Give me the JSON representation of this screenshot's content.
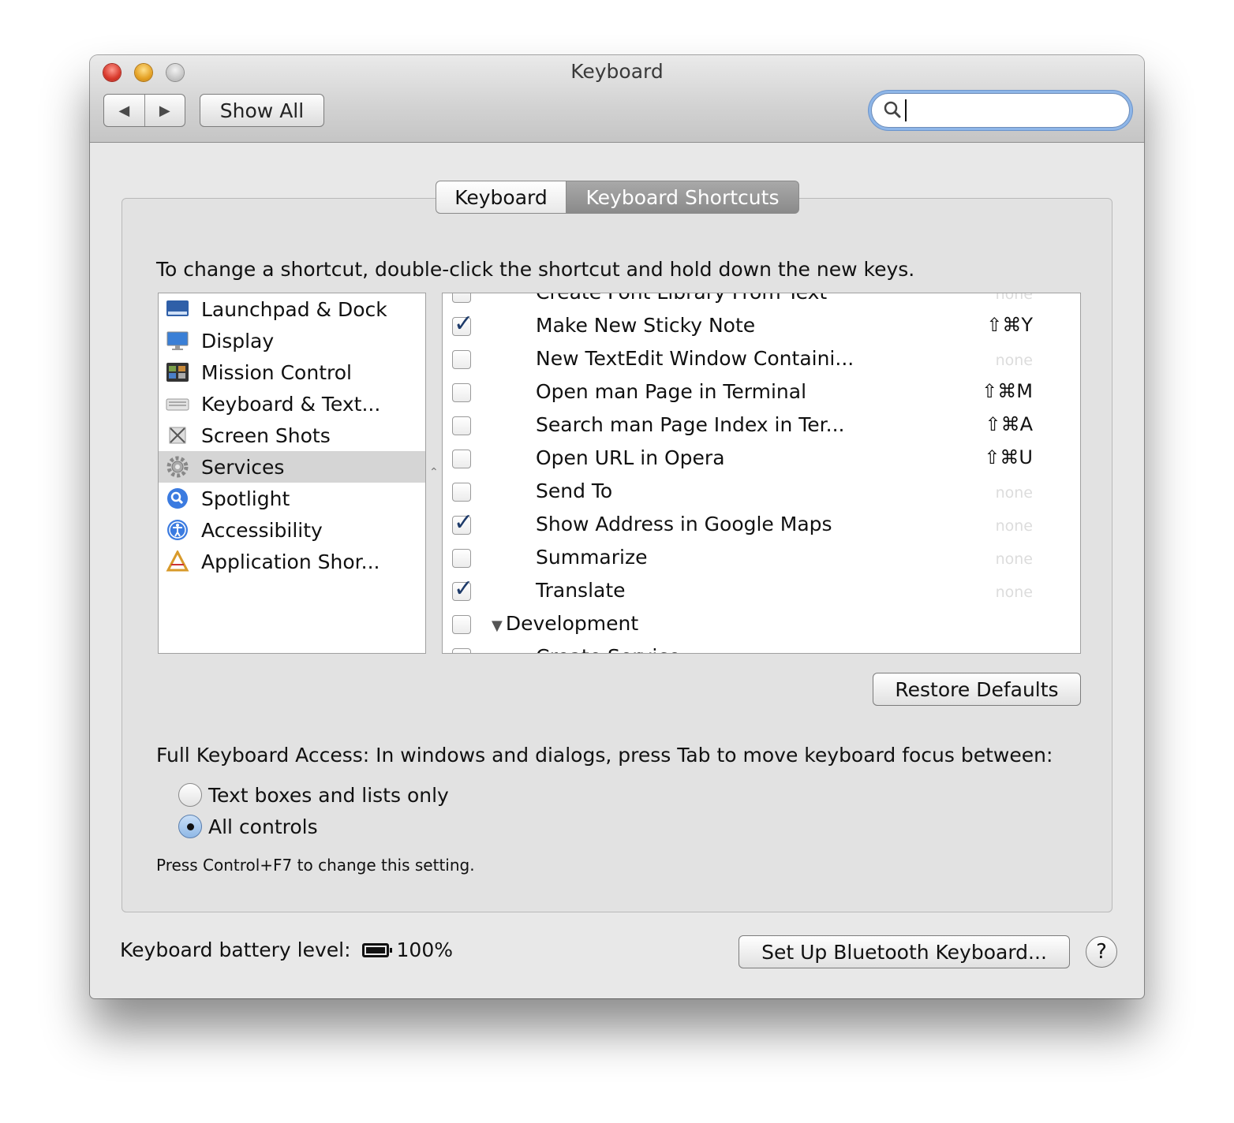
{
  "window": {
    "title": "Keyboard",
    "nav": {
      "back_icon": "◀",
      "forward_icon": "▶"
    },
    "show_all_label": "Show All",
    "search": {
      "value": "",
      "placeholder": ""
    }
  },
  "tabs": [
    {
      "label": "Keyboard",
      "selected": false
    },
    {
      "label": "Keyboard Shortcuts",
      "selected": true
    }
  ],
  "instruction": "To change a shortcut, double-click the shortcut and hold down the new keys.",
  "categories": [
    {
      "label": "Launchpad & Dock",
      "icon": "launchpad-dock-icon",
      "selected": false
    },
    {
      "label": "Display",
      "icon": "display-icon",
      "selected": false
    },
    {
      "label": "Mission Control",
      "icon": "mission-control-icon",
      "selected": false
    },
    {
      "label": "Keyboard & Text...",
      "icon": "keyboard-icon",
      "selected": false
    },
    {
      "label": "Screen Shots",
      "icon": "screenshot-icon",
      "selected": false
    },
    {
      "label": "Services",
      "icon": "gear-icon",
      "selected": true
    },
    {
      "label": "Spotlight",
      "icon": "spotlight-icon",
      "selected": false
    },
    {
      "label": "Accessibility",
      "icon": "accessibility-icon",
      "selected": false
    },
    {
      "label": "Application Shor...",
      "icon": "app-shortcuts-icon",
      "selected": false
    }
  ],
  "services": [
    {
      "label": "Create Font Library From Text",
      "checked": false,
      "shortcut": "none"
    },
    {
      "label": "Make New Sticky Note",
      "checked": true,
      "shortcut": "⇧⌘Y"
    },
    {
      "label": "New TextEdit Window Containi...",
      "checked": false,
      "shortcut": "none"
    },
    {
      "label": "Open man Page in Terminal",
      "checked": false,
      "shortcut": "⇧⌘M"
    },
    {
      "label": "Search man Page Index in Ter...",
      "checked": false,
      "shortcut": "⇧⌘A"
    },
    {
      "label": "Open URL in Opera",
      "checked": false,
      "shortcut": "⇧⌘U"
    },
    {
      "label": "Send To",
      "checked": false,
      "shortcut": "none"
    },
    {
      "label": "Show Address in Google Maps",
      "checked": true,
      "shortcut": "none"
    },
    {
      "label": "Summarize",
      "checked": false,
      "shortcut": "none"
    },
    {
      "label": "Translate",
      "checked": true,
      "shortcut": "none"
    }
  ],
  "services_group": {
    "label": "Development",
    "checked": false,
    "expanded": true
  },
  "services_next": {
    "label": "Create Service",
    "checked": false
  },
  "restore_defaults_label": "Restore Defaults",
  "full_keyboard_access": {
    "label": "Full Keyboard Access: In windows and dialogs, press Tab to move keyboard focus between:",
    "options": [
      {
        "label": "Text boxes and lists only",
        "selected": false
      },
      {
        "label": "All controls",
        "selected": true
      }
    ],
    "hint": "Press Control+F7 to change this setting."
  },
  "battery": {
    "label": "Keyboard battery level:",
    "value": "100%",
    "level": 1.0
  },
  "bluetooth_button_label": "Set Up Bluetooth Keyboard...",
  "help_label": "?",
  "colors": {
    "accent": "#8eb6e8",
    "selection": "#d5d5d5",
    "check": "#1e3b6a"
  }
}
